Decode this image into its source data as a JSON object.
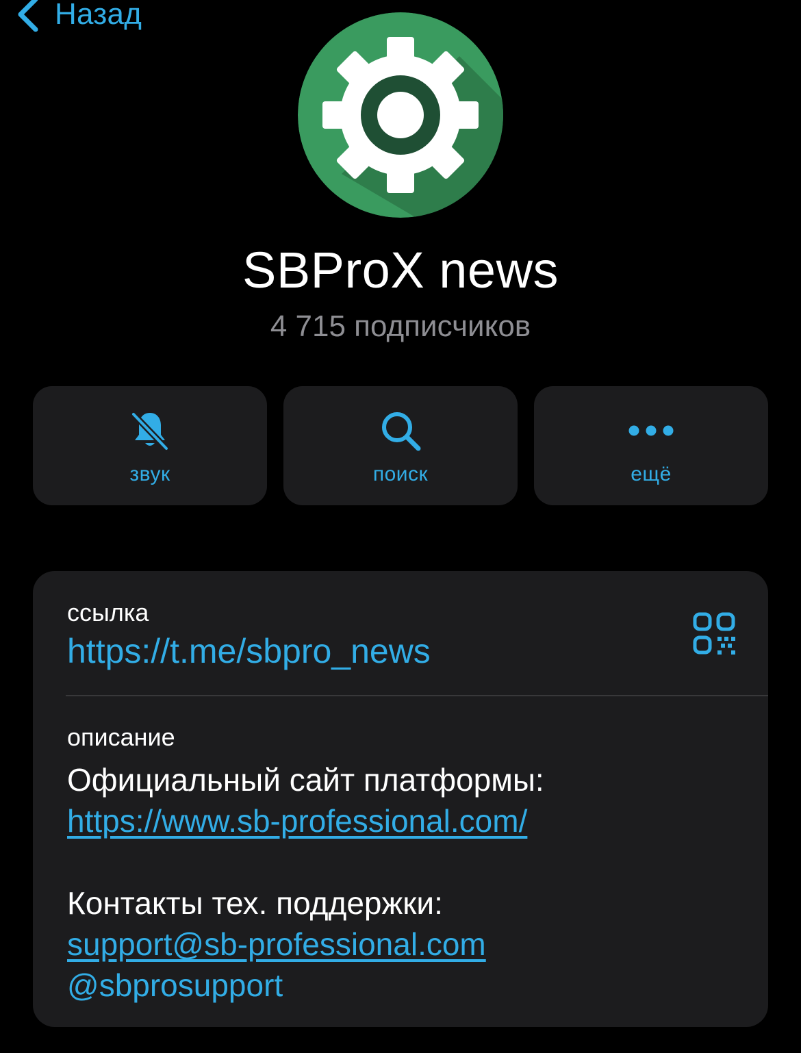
{
  "nav": {
    "back_label": "Назад"
  },
  "channel": {
    "name": "SBProX news",
    "subscribers": "4 715 подписчиков",
    "avatar_icon": "gear-icon",
    "avatar_color": "#3a9b5f"
  },
  "actions": [
    {
      "label": "звук",
      "icon": "bell-slash-icon"
    },
    {
      "label": "поиск",
      "icon": "search-icon"
    },
    {
      "label": "ещё",
      "icon": "ellipsis-icon"
    }
  ],
  "info": {
    "link_label": "ссылка",
    "link_url": "https://t.me/sbpro_news",
    "qr_icon": "qr-code-icon",
    "description_label": "описание",
    "description_line1": "Официальный сайт платформы:",
    "description_site": "https://www.sb-professional.com/",
    "description_line2": "Контакты тех. поддержки:",
    "description_email": "support@sb-professional.com",
    "description_handle": "@sbprosupport"
  },
  "colors": {
    "accent": "#32ade6",
    "background": "#000000",
    "card": "#1c1c1e",
    "secondary_text": "#8e8e93"
  }
}
